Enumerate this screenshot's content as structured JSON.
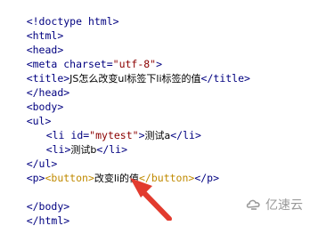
{
  "code": {
    "l1": "<!doctype html>",
    "l2": "<html>",
    "l3": "<head>",
    "l4_open": "<meta charset=",
    "l4_val": "\"utf-8\"",
    "l4_close": ">",
    "l5_open": "<title>",
    "l5_text": "JS怎么改变ul标签下li标签的值",
    "l5_close": "</title>",
    "l6": "</head>",
    "l7": "<body>",
    "l8": "<ul>",
    "l9_open": "<li id=",
    "l9_val": "\"mytest\"",
    "l9_gt": ">",
    "l9_text": "测试a",
    "l9_close": "</li>",
    "l10_open": "<li>",
    "l10_text": "测试b",
    "l10_close": "</li>",
    "l11": "</ul>",
    "l12_p_open": "<p>",
    "l12_btn_open": "<button>",
    "l12_text": "改变li的值",
    "l12_btn_close": "</button>",
    "l12_p_close": "</p>",
    "l14": "</body>",
    "l15": "</html>"
  },
  "watermark": {
    "text": "亿速云"
  },
  "colors": {
    "tag": "#000080",
    "string": "#8b0000",
    "button_tag": "#c08a00",
    "arrow": "#e23b2e"
  }
}
